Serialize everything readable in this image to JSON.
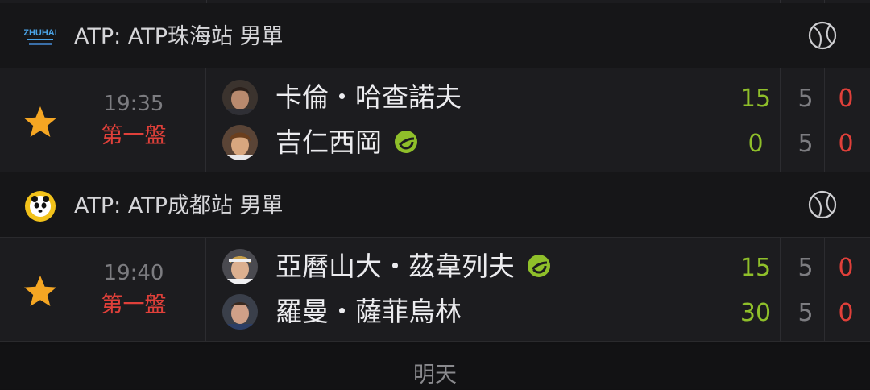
{
  "leagues": [
    {
      "title": "ATP: ATP珠海站 男單",
      "logo_icon": "zhuhai-championships-logo",
      "logo_text": "ZHUHAI",
      "match": {
        "time": "19:35",
        "status": "第一盤",
        "favorite": true,
        "players": [
          {
            "name": "卡倫・哈查諾夫",
            "serving": false,
            "point": "15",
            "set1": "5",
            "set2": "0"
          },
          {
            "name": "吉仁西岡",
            "serving": true,
            "point": "0",
            "set1": "5",
            "set2": "0"
          }
        ]
      }
    },
    {
      "title": "ATP: ATP成都站 男單",
      "logo_icon": "chengdu-open-panda-logo",
      "match": {
        "time": "19:40",
        "status": "第一盤",
        "favorite": true,
        "players": [
          {
            "name": "亞曆山大・茲韋列夫",
            "serving": true,
            "point": "15",
            "set1": "5",
            "set2": "0"
          },
          {
            "name": "羅曼・薩菲烏林",
            "serving": false,
            "point": "30",
            "set1": "5",
            "set2": "0"
          }
        ]
      }
    }
  ],
  "day_divider": "明天",
  "colors": {
    "point": "#8fbf2a",
    "live_set": "#e0403a",
    "status": "#e0403a",
    "star": "#f5a623",
    "serve": "#8fbf2a"
  }
}
